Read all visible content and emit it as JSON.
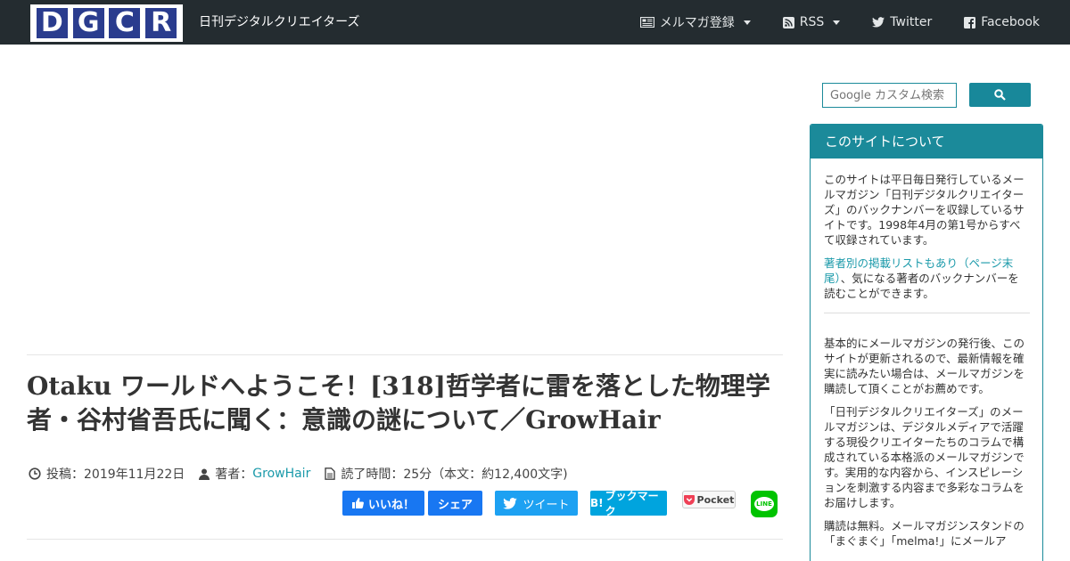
{
  "header": {
    "logo_letters": [
      "D",
      "G",
      "C",
      "R"
    ],
    "site_name": "日刊デジタルクリエイターズ",
    "nav": [
      {
        "label": "メルマガ登録",
        "icon": "newspaper-icon",
        "dropdown": true
      },
      {
        "label": "RSS",
        "icon": "rss-icon",
        "dropdown": true
      },
      {
        "label": "Twitter",
        "icon": "twitter-icon",
        "dropdown": false
      },
      {
        "label": "Facebook",
        "icon": "facebook-icon",
        "dropdown": false
      }
    ]
  },
  "article": {
    "title": "Otaku ワールドへようこそ！[318]哲学者に雷を落とした物理学者・谷村省吾氏に聞く：意識の謎について／GrowHair",
    "posted_label": "投稿：",
    "posted_date": "2019年11月22日",
    "author_label": "著者：",
    "author": "GrowHair",
    "reading_time": "読了時間：25分（本文：約12,400文字)"
  },
  "share": {
    "fb_like": "いいね！",
    "fb_share": "シェア",
    "tweet": "ツイート",
    "hatena": "ブックマーク",
    "hatena_logo": "B!",
    "pocket": "Pocket",
    "line": "LINE"
  },
  "sidebar": {
    "search_placeholder": "Google カスタム検索",
    "panel_title": "このサイトについて",
    "p1": "このサイトは平日毎日発行しているメールマガジン「日刊デジタルクリエイターズ」のバックナンバーを収録しているサイトです。1998年4月の第1号からすべて収録されています。",
    "p2_link": "著者別の掲載リストもあり（ページ末尾）",
    "p2_rest": "、気になる著者のバックナンバーを読むことができます。",
    "p3": "基本的にメールマガジンの発行後、このサイトが更新されるので、最新情報を確実に読みたい場合は、メールマガジンを購読して頂くことがお薦めです。",
    "p4": "「日刊デジタルクリエイターズ」のメールマガジンは、デジタルメディアで活躍する現役クリエイターたちのコラムで構成されている本格派のメールマガジンです。実用的な内容から、インスピレーションを刺激する内容まで多彩なコラムをお届けします。",
    "p5": "購読は無料。メールマガジンスタンドの「まぐまぐ」「melma!」にメールア"
  },
  "colors": {
    "header_bg": "#242c30",
    "logo_blue": "#2a3c8e",
    "accent_teal": "#1b8a9a",
    "facebook_blue": "#1877f2",
    "twitter_blue": "#1da1f2",
    "hatena_blue": "#00a4de",
    "line_green": "#00c300"
  }
}
